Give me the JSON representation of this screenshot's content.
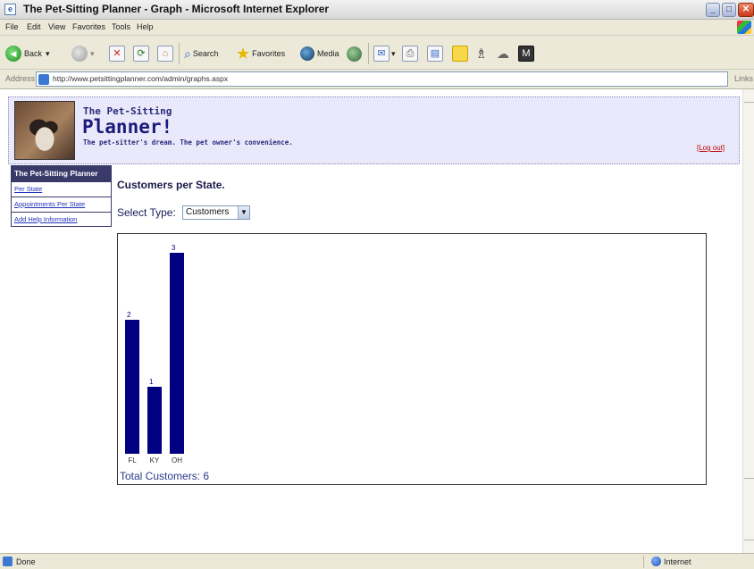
{
  "window": {
    "title": "The Pet-Sitting Planner - Graph - Microsoft Internet Explorer"
  },
  "menu": [
    "File",
    "Edit",
    "View",
    "Favorites",
    "Tools",
    "Help"
  ],
  "toolbar": {
    "back": "Back",
    "search": "Search",
    "favorites": "Favorites",
    "media": "Media"
  },
  "address": {
    "label": "Address",
    "url": "http://www.petsittingplanner.com/admin/graphs.aspx",
    "links": "Links"
  },
  "header": {
    "brand_small": "The Pet-Sitting",
    "brand_big": "Planner!",
    "tagline": "The pet-sitter's dream. The pet owner's convenience.",
    "logout": "[Log out]"
  },
  "nav": {
    "heading": "The Pet-Sitting Planner",
    "items": [
      "Per State",
      "Appointments Per State",
      "Add Help Information"
    ]
  },
  "page": {
    "title": "Customers per State.",
    "select_label": "Select Type:",
    "select_value": "Customers"
  },
  "chart_data": {
    "type": "bar",
    "categories": [
      "FL",
      "KY",
      "OH"
    ],
    "values": [
      2,
      1,
      3
    ],
    "title": "",
    "xlabel": "",
    "ylabel": "",
    "ylim": [
      0,
      3
    ],
    "bar_color": "#000080",
    "grid": false
  },
  "chart_footer": "Total Customers: 6",
  "status": {
    "text": "Done",
    "zone": "Internet"
  },
  "colors": {
    "accent": "#3a3a6a",
    "header_bg": "#e9e9fb",
    "link": "#2233bb",
    "logout": "#c00000"
  }
}
